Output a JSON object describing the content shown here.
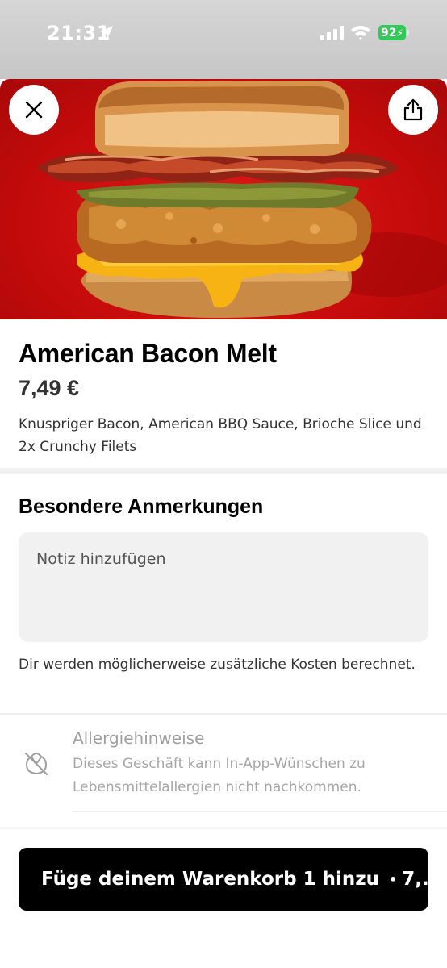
{
  "status_bar": {
    "time": "21:31",
    "battery": "92",
    "icons": [
      "location-arrow-icon",
      "cellular-signal-icon",
      "wifi-icon",
      "battery-charging-icon"
    ]
  },
  "hero": {
    "image": "american-bacon-melt-photo",
    "close_icon": "close-icon",
    "share_icon": "share-icon"
  },
  "product": {
    "title": "American Bacon Melt",
    "price": "7,49 €",
    "description": "Knuspriger Bacon, American BBQ Sauce, Brioche Slice und 2x Crunchy Filets"
  },
  "notes": {
    "heading": "Besondere Anmerkungen",
    "placeholder": "Notiz hinzufügen",
    "cost_hint": "Dir werden möglicherweise zusätzliche Kosten berechnet."
  },
  "allergy": {
    "icon": "allergy-leaf-icon",
    "title": "Allergiehinweise",
    "text": "Dieses Geschäft kann In-App-Wünschen zu Lebensmittelallergien nicht nachkommen."
  },
  "cart_button": {
    "label": "Füge deinem Warenkorb 1 hinzu",
    "separator": "•",
    "price_truncated": "7,..."
  },
  "colors": {
    "hero_red": "#d11111",
    "battery_green": "#34c759",
    "button_black": "#000000",
    "muted_text": "#9e9e9e"
  }
}
